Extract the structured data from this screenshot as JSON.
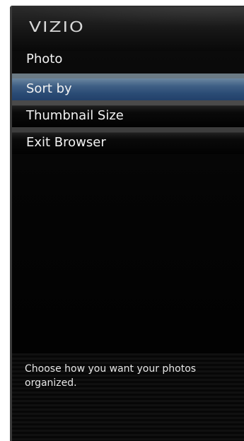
{
  "brand": {
    "logo_text": "VIZIO"
  },
  "menu": {
    "items": [
      {
        "label": "Photo"
      },
      {
        "label": "Sort by",
        "selected": true
      },
      {
        "label": "Thumbnail Size"
      },
      {
        "label": "Exit Browser"
      }
    ]
  },
  "help": {
    "text": "Choose how you want your photos organized."
  },
  "colors": {
    "selection": "#2a4b74",
    "background": "#000000",
    "text": "#f2f2f2"
  }
}
